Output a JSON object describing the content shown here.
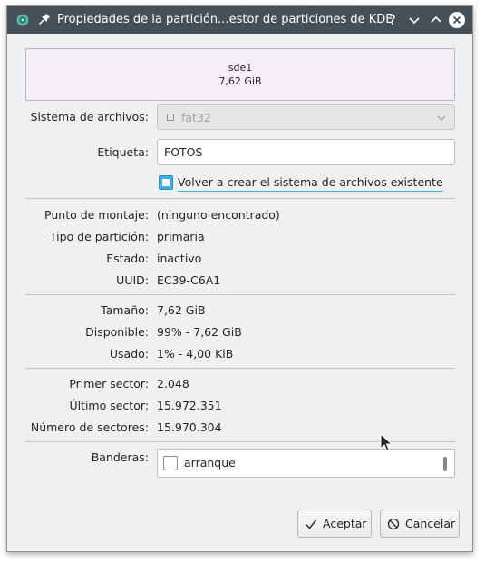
{
  "window": {
    "title": "Propiedades de la partición...estor de particiones de KDE",
    "buttons": [
      "help",
      "minimize",
      "maximize",
      "close"
    ]
  },
  "partition": {
    "name": "sde1",
    "size": "7,62 GiB"
  },
  "form": {
    "filesystem_label": "Sistema de archivos:",
    "filesystem_value": "fat32",
    "label_label": "Etiqueta:",
    "label_value": "FOTOS",
    "recreate_checkbox_label": "Volver a crear el sistema de archivos existente",
    "recreate_checked": true
  },
  "info": {
    "mount_label": "Punto de montaje:",
    "mount_value": "(ninguno encontrado)",
    "type_label": "Tipo de partición:",
    "type_value": "primaria",
    "state_label": "Estado:",
    "state_value": "inactivo",
    "uuid_label": "UUID:",
    "uuid_value": "EC39-C6A1"
  },
  "usage": {
    "size_label": "Tamaño:",
    "size_value": "7,62 GiB",
    "available_label": "Disponible:",
    "available_value": "99% - 7,62 GiB",
    "used_label": "Usado:",
    "used_value": "1% - 4,00 KiB"
  },
  "sectors": {
    "first_label": "Primer sector:",
    "first_value": "2.048",
    "last_label": "Último sector:",
    "last_value": "15.972.351",
    "count_label": "Número de sectores:",
    "count_value": "15.970.304"
  },
  "flags": {
    "label": "Banderas:",
    "items": [
      {
        "label": "arranque",
        "checked": false
      }
    ]
  },
  "actions": {
    "ok_label": "Aceptar",
    "cancel_label": "Cancelar"
  },
  "colors": {
    "titlebar": "#475057",
    "accent": "#3daee9",
    "window_bg": "#eff0f1",
    "partition_fill": "#f6eef6"
  }
}
